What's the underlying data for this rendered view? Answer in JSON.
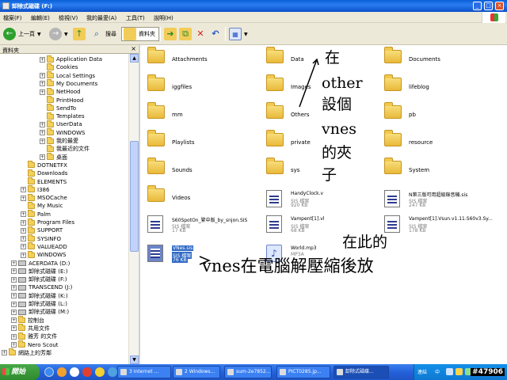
{
  "window": {
    "title": "卸除式磁碟 (F:)"
  },
  "menu": [
    "檔案(F)",
    "編輯(E)",
    "檢視(V)",
    "我的最愛(A)",
    "工具(T)",
    "說明(H)"
  ],
  "toolbar": {
    "back_label": "上一頁",
    "search_label": "搜尋",
    "folders_label": "資料夾"
  },
  "folder_pane": {
    "header": "資料夾",
    "close": "×",
    "tree": [
      {
        "label": "Application Data",
        "expander": "+",
        "kind": "folder",
        "level": 2
      },
      {
        "label": "Cookies",
        "expander": "",
        "kind": "folder",
        "level": 2
      },
      {
        "label": "Local Settings",
        "expander": "+",
        "kind": "folder",
        "level": 2
      },
      {
        "label": "My Documents",
        "expander": "+",
        "kind": "folder",
        "level": 2
      },
      {
        "label": "NetHood",
        "expander": "+",
        "kind": "folder",
        "level": 2
      },
      {
        "label": "PrintHood",
        "expander": "",
        "kind": "folder",
        "level": 2
      },
      {
        "label": "SendTo",
        "expander": "",
        "kind": "folder",
        "level": 2
      },
      {
        "label": "Templates",
        "expander": "",
        "kind": "folder",
        "level": 2
      },
      {
        "label": "UserData",
        "expander": "+",
        "kind": "folder",
        "level": 2
      },
      {
        "label": "WINDOWS",
        "expander": "+",
        "kind": "folder",
        "level": 2
      },
      {
        "label": "我的最愛",
        "expander": "+",
        "kind": "folder",
        "level": 2
      },
      {
        "label": "我最近的文件",
        "expander": "",
        "kind": "folder",
        "level": 2
      },
      {
        "label": "桌面",
        "expander": "+",
        "kind": "folder",
        "level": 2
      },
      {
        "label": "DOTNETFX",
        "expander": "",
        "kind": "folder",
        "level": 1
      },
      {
        "label": "Downloads",
        "expander": "",
        "kind": "folder",
        "level": 1
      },
      {
        "label": "ELEMENTS",
        "expander": "",
        "kind": "folder",
        "level": 1
      },
      {
        "label": "I386",
        "expander": "+",
        "kind": "folder",
        "level": 1
      },
      {
        "label": "MSOCache",
        "expander": "+",
        "kind": "folder",
        "level": 1
      },
      {
        "label": "My Music",
        "expander": "",
        "kind": "folder",
        "level": 1
      },
      {
        "label": "Palm",
        "expander": "+",
        "kind": "folder",
        "level": 1
      },
      {
        "label": "Program Files",
        "expander": "+",
        "kind": "folder",
        "level": 1
      },
      {
        "label": "SUPPORT",
        "expander": "+",
        "kind": "folder",
        "level": 1
      },
      {
        "label": "SYSINFO",
        "expander": "+",
        "kind": "folder",
        "level": 1
      },
      {
        "label": "VALUEADD",
        "expander": "+",
        "kind": "folder",
        "level": 1
      },
      {
        "label": "WINDOWS",
        "expander": "+",
        "kind": "folder",
        "level": 1
      },
      {
        "label": "ACERDATA (D:)",
        "expander": "+",
        "kind": "drive",
        "level": 0
      },
      {
        "label": "卸除式磁碟 (E:)",
        "expander": "+",
        "kind": "drive",
        "level": 0
      },
      {
        "label": "卸除式磁碟 (F:)",
        "expander": "+",
        "kind": "drive",
        "level": 0
      },
      {
        "label": "TRANSCEND (J:)",
        "expander": "+",
        "kind": "drive",
        "level": 0
      },
      {
        "label": "卸除式磁碟 (K:)",
        "expander": "+",
        "kind": "drive",
        "level": 0
      },
      {
        "label": "卸除式磁碟 (L:)",
        "expander": "+",
        "kind": "drive",
        "level": 0
      },
      {
        "label": "卸除式磁碟 (M:)",
        "expander": "+",
        "kind": "drive",
        "level": 0
      },
      {
        "label": "控制台",
        "expander": "+",
        "kind": "folder",
        "level": 0
      },
      {
        "label": "共用文件",
        "expander": "+",
        "kind": "folder",
        "level": 0
      },
      {
        "label": "雅芳 的文件",
        "expander": "+",
        "kind": "folder",
        "level": 0
      },
      {
        "label": "Nero Scout",
        "expander": "+",
        "kind": "folder",
        "level": 0
      },
      {
        "label": "網路上的芳鄰",
        "expander": "+",
        "kind": "folder",
        "level": -1
      }
    ]
  },
  "files": {
    "folders": [
      {
        "name": "Attachments"
      },
      {
        "name": "Data"
      },
      {
        "name": "Documents"
      },
      {
        "name": "iggfiles"
      },
      {
        "name": "Images"
      },
      {
        "name": "lifeblog"
      },
      {
        "name": "mm"
      },
      {
        "name": "Others"
      },
      {
        "name": "pb"
      },
      {
        "name": "Playlists"
      },
      {
        "name": "private"
      },
      {
        "name": "resource"
      },
      {
        "name": "Sounds"
      },
      {
        "name": "sys"
      },
      {
        "name": "System"
      },
      {
        "name": "Videos"
      }
    ],
    "files": [
      {
        "name": "HandyClock.v",
        "type": "SIS 檔案",
        "size": "920 KB",
        "icon": "sis"
      },
      {
        "name": "N第三版可用超級錄音機.sis",
        "type": "SIS 檔案",
        "size": "247 KB",
        "icon": "sis"
      },
      {
        "name": "S60SpotOn_繁中版_by_snjon.SIS",
        "type": "SIS 檔案",
        "size": "17 KB",
        "icon": "sis"
      },
      {
        "name": "Vampent[1].vl",
        "type": "SIS 檔案",
        "size": "68 KB",
        "icon": "sis"
      },
      {
        "name": "Vampent[1].Vsun.v1.11.S60v3.Sy...",
        "type": "SIS 檔案",
        "size": "178 KB",
        "icon": "sis"
      },
      {
        "name": "VNes.sis",
        "type": "SIS 檔案",
        "size": "76 KB",
        "icon": "sis",
        "selected": true
      },
      {
        "name": "World.mp3",
        "type": "MP3A",
        "size": "",
        "icon": "music"
      }
    ]
  },
  "annotations": {
    "top_lines": [
      "在",
      "other",
      "設個",
      "vnes",
      "的夾",
      "子"
    ],
    "bottom_line1": "在此的",
    "bottom_line2": "vnes在電腦解壓縮後放"
  },
  "taskbar": {
    "start": "開始",
    "tasks": [
      "3 Internet ...",
      "2 Windows...",
      "sum-2e7852...",
      "PICT0285.jp...",
      "卸除式磁碟..."
    ],
    "tray_text": "連結",
    "tray_ime": "中"
  },
  "watermark": "#47906"
}
